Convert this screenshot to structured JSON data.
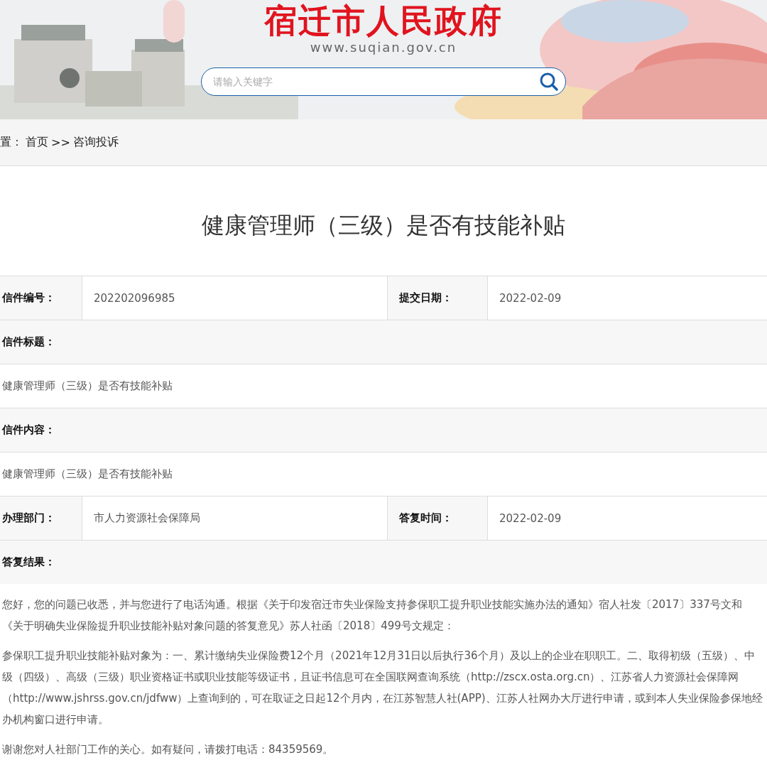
{
  "header": {
    "title": "宿迁市人民政府",
    "url": "www.suqian.gov.cn",
    "search": {
      "placeholder": "请输入关键字"
    }
  },
  "breadcrumb": [
    {
      "text": "置："
    },
    {
      "text": "首页"
    },
    {
      "text": ">>"
    },
    {
      "text": "咨询投诉"
    }
  ],
  "article_title": "健康管理师（三级）是否有技能补贴",
  "rows": [
    {
      "kind": "pair",
      "cells": [
        {
          "label": "信件编号：",
          "value": "202202096985"
        },
        {
          "label": "提交日期：",
          "value": "2022-02-09"
        }
      ]
    },
    {
      "kind": "label",
      "text": "信件标题："
    },
    {
      "kind": "value",
      "text": "健康管理师（三级）是否有技能补贴"
    },
    {
      "kind": "label",
      "text": "信件内容："
    },
    {
      "kind": "value",
      "text": "健康管理师（三级）是否有技能补贴"
    },
    {
      "kind": "pair",
      "cells": [
        {
          "label": "办理部门：",
          "value": "市人力资源社会保障局"
        },
        {
          "label": "答复时间：",
          "value": "2022-02-09"
        }
      ]
    },
    {
      "kind": "label",
      "text": "答复结果："
    }
  ],
  "reply": [
    "您好，您的问题已收悉，并与您进行了电话沟通。根据《关于印发宿迁市失业保险支持参保职工提升职业技能实施办法的通知》宿人社发〔2017〕337号文和《关于明确失业保险提升职业技能补贴对象问题的答复意见》苏人社函〔2018〕499号文规定：",
    "参保职工提升职业技能补贴对象为：一、累计缴纳失业保险费12个月（2021年12月31日以后执行36个月）及以上的企业在职职工。二、取得初级（五级）、中级（四级）、高级（三级）职业资格证书或职业技能等级证书，且证书信息可在全国联网查询系统（http://zscx.osta.org.cn）、江苏省人力资源社会保障网（http://www.jshrss.gov.cn/jdfww）上查询到的，可在取证之日起12个月内，在江苏智慧人社(APP)、江苏人社网办大厅进行申请，或到本人失业保险参保地经办机构窗口进行申请。",
    "谢谢您对人社部门工作的关心。如有疑问，请拨打电话：84359569。"
  ]
}
